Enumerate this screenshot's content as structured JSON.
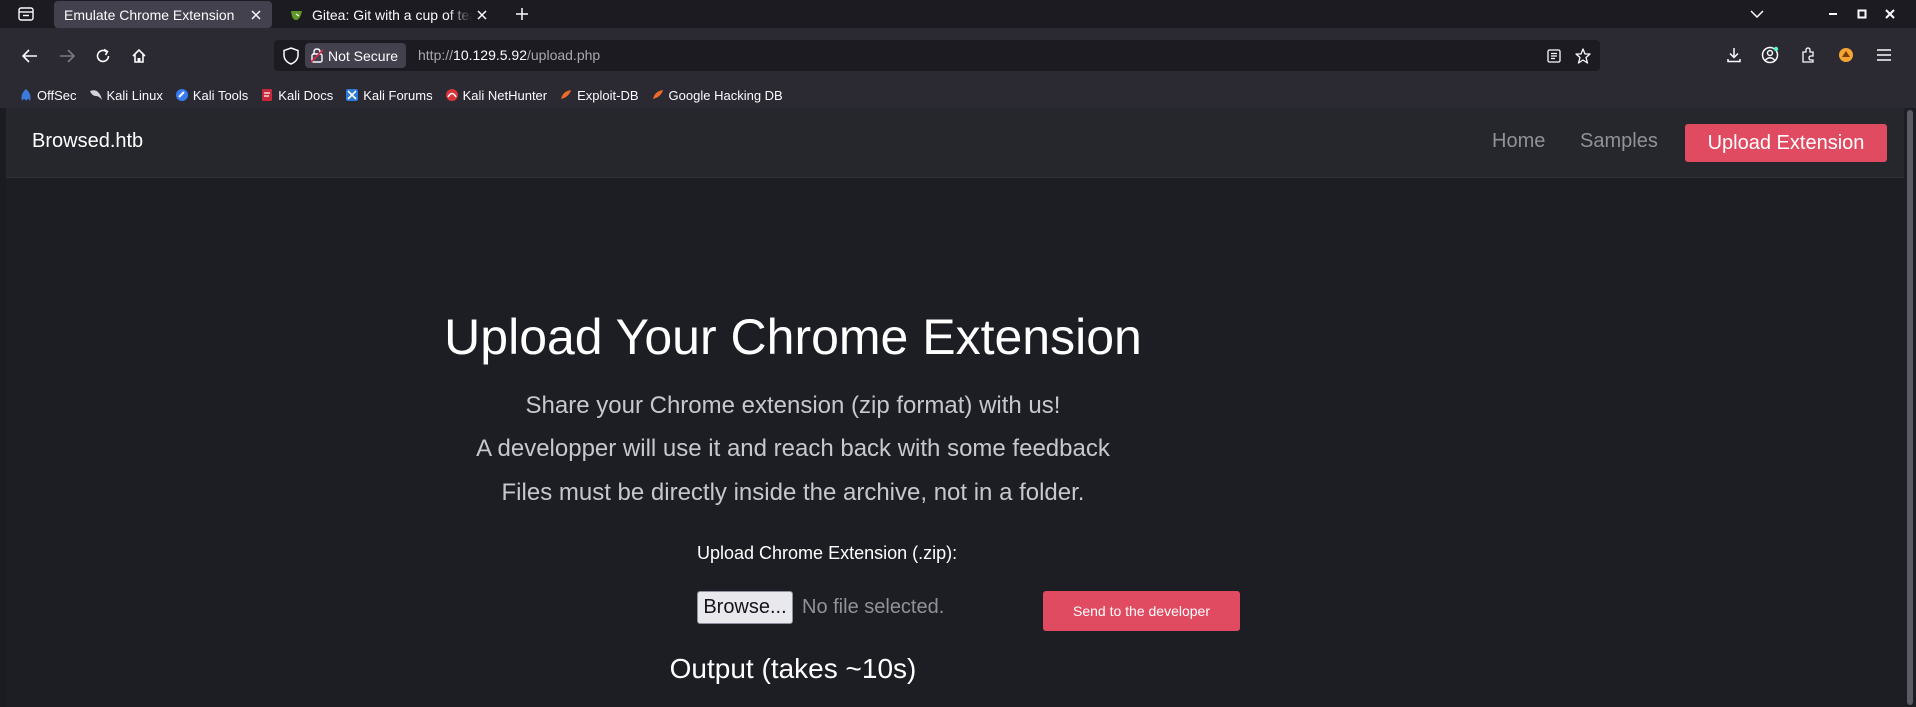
{
  "browser": {
    "tabs": [
      {
        "title": "Emulate Chrome Extension",
        "active": true
      },
      {
        "title": "Gitea: Git with a cup of tea",
        "active": false
      }
    ],
    "security_label": "Not Secure",
    "url": {
      "scheme": "http://",
      "host": "10.129.5.92",
      "path": "/upload.php"
    },
    "bookmarks": [
      {
        "label": "OffSec",
        "icon": "offsec-icon"
      },
      {
        "label": "Kali Linux",
        "icon": "kali-dragon-icon"
      },
      {
        "label": "Kali Tools",
        "icon": "kali-tools-icon"
      },
      {
        "label": "Kali Docs",
        "icon": "kali-docs-icon"
      },
      {
        "label": "Kali Forums",
        "icon": "kali-forums-icon"
      },
      {
        "label": "Kali NetHunter",
        "icon": "nethunter-icon"
      },
      {
        "label": "Exploit-DB",
        "icon": "exploit-db-icon"
      },
      {
        "label": "Google Hacking DB",
        "icon": "ghdb-icon"
      }
    ]
  },
  "site": {
    "brand": "Browsed.htb",
    "nav": {
      "home": "Home",
      "samples": "Samples",
      "upload": "Upload Extension"
    },
    "heading": "Upload Your Chrome Extension",
    "lead_lines": [
      "Share your Chrome extension (zip format) with us!",
      "A developper will use it and reach back with some feedback",
      "Files must be directly inside the archive, not in a folder."
    ],
    "form": {
      "label": "Upload Chrome Extension (.zip):",
      "browse": "Browse...",
      "no_file": "No file selected.",
      "submit": "Send to the developer"
    },
    "output_heading": "Output (takes ~10s)"
  },
  "colors": {
    "accent": "#e04b62",
    "page_bg": "#1d1e24",
    "nav_bg": "#26272d"
  }
}
